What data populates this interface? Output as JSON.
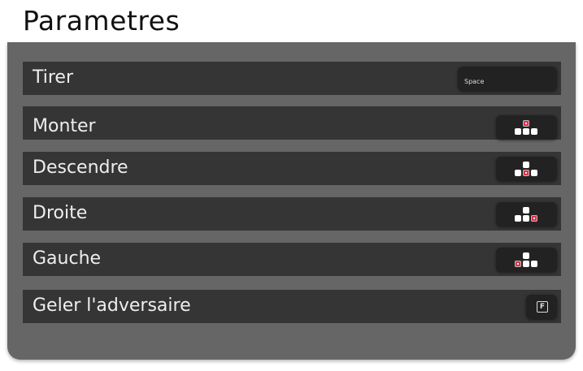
{
  "title": "Parametres",
  "bindings": [
    {
      "action": "Tirer",
      "key": "Space",
      "type": "text"
    },
    {
      "action": "Monter",
      "key": "up",
      "type": "arrow"
    },
    {
      "action": "Descendre",
      "key": "down",
      "type": "arrow"
    },
    {
      "action": "Droite",
      "key": "right",
      "type": "arrow"
    },
    {
      "action": "Gauche",
      "key": "left",
      "type": "arrow"
    },
    {
      "action": "Geler l'adversaire",
      "key": "F",
      "type": "letter"
    }
  ],
  "colors": {
    "highlight": "#e03048",
    "row": "#353535",
    "panel": "#666666"
  }
}
